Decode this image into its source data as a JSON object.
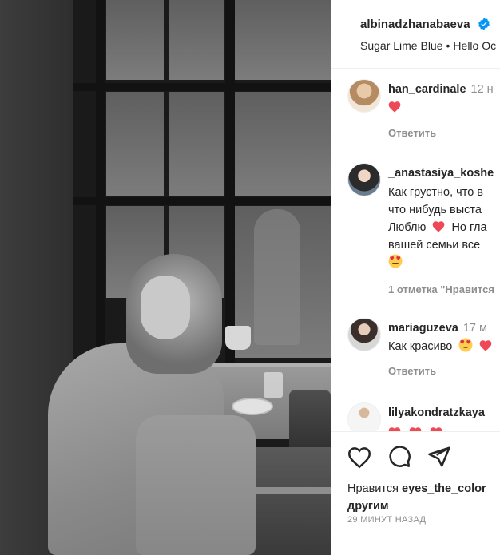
{
  "post": {
    "username": "albinadzhanabaeva",
    "audio_track": "Sugar Lime Blue",
    "audio_artist": "Hello Oc"
  },
  "comments": [
    {
      "username": "han_cardinale",
      "time": "12 н",
      "text": "",
      "emoji": "heart",
      "meta": "Ответить"
    },
    {
      "username": "_anastasiya_koshe",
      "time": "",
      "lines": [
        "Как грустно, что в",
        "что нибудь выста",
        "Люблю",
        "Но гла",
        "вашей семьи все"
      ],
      "meta": "1 отметка \"Нравится"
    },
    {
      "username": "mariaguzeva",
      "time": "17 м",
      "text": "Как красиво",
      "meta": "Ответить"
    },
    {
      "username": "lilyakondratzkaya",
      "time": "",
      "text": ""
    }
  ],
  "actions": {
    "likes_prefix": "Нравится",
    "likes_user": "eyes_the_color",
    "likes_suffix": "другим",
    "time_ago": "29 МИНУТ НАЗАД"
  },
  "colors": {
    "heart": "#ed4956",
    "verified": "#0095f6",
    "muted": "#8e8e8e",
    "text": "#262626"
  }
}
